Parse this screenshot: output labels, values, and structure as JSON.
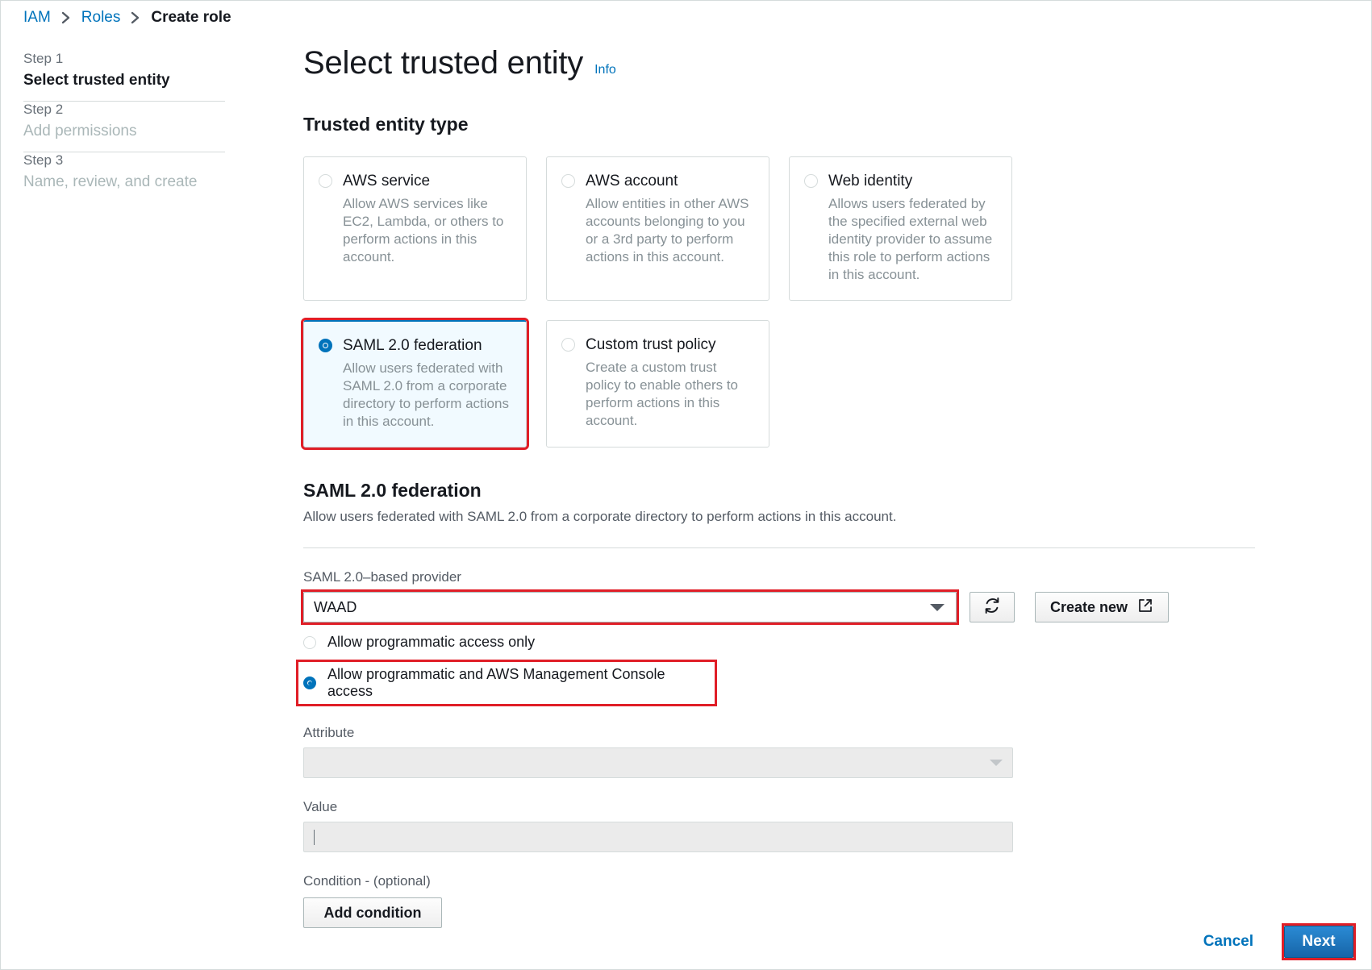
{
  "breadcrumb": {
    "items": [
      {
        "label": "IAM",
        "type": "link"
      },
      {
        "label": "Roles",
        "type": "link"
      },
      {
        "label": "Create role",
        "type": "current"
      }
    ]
  },
  "wizard_steps": [
    {
      "num": "Step 1",
      "title": "Select trusted entity",
      "active": true
    },
    {
      "num": "Step 2",
      "title": "Add permissions",
      "active": false
    },
    {
      "num": "Step 3",
      "title": "Name, review, and create",
      "active": false
    }
  ],
  "header": {
    "title": "Select trusted entity",
    "info_link": "Info"
  },
  "trusted_entity": {
    "section_title": "Trusted entity type",
    "options": [
      {
        "label": "AWS service",
        "description": "Allow AWS services like EC2, Lambda, or others to perform actions in this account.",
        "selected": false,
        "highlighted": false
      },
      {
        "label": "AWS account",
        "description": "Allow entities in other AWS accounts belonging to you or a 3rd party to perform actions in this account.",
        "selected": false,
        "highlighted": false
      },
      {
        "label": "Web identity",
        "description": "Allows users federated by the specified external web identity provider to assume this role to perform actions in this account.",
        "selected": false,
        "highlighted": false
      },
      {
        "label": "SAML 2.0 federation",
        "description": "Allow users federated with SAML 2.0 from a corporate directory to perform actions in this account.",
        "selected": true,
        "highlighted": true
      },
      {
        "label": "Custom trust policy",
        "description": "Create a custom trust policy to enable others to perform actions in this account.",
        "selected": false,
        "highlighted": false
      }
    ]
  },
  "saml_section": {
    "title": "SAML 2.0 federation",
    "description": "Allow users federated with SAML 2.0 from a corporate directory to perform actions in this account.",
    "provider_label": "SAML 2.0–based provider",
    "provider_value": "WAAD",
    "refresh_icon": "refresh-icon",
    "create_new_label": "Create new",
    "create_new_icon": "external-link-icon",
    "access_options": [
      {
        "label": "Allow programmatic access only",
        "selected": false,
        "highlighted": false
      },
      {
        "label": "Allow programmatic and AWS Management Console access",
        "selected": true,
        "highlighted": true
      }
    ],
    "attribute_label": "Attribute",
    "attribute_value": "",
    "value_label": "Value",
    "value_value": "",
    "condition_label": "Condition - (optional)",
    "add_condition_label": "Add condition"
  },
  "footer": {
    "cancel_label": "Cancel",
    "next_label": "Next",
    "next_highlighted": true
  },
  "colors": {
    "link": "#0073bb",
    "highlight_red": "#e01e27",
    "selected_card_bg": "#f1faff",
    "primary_button": "#1765a8"
  }
}
